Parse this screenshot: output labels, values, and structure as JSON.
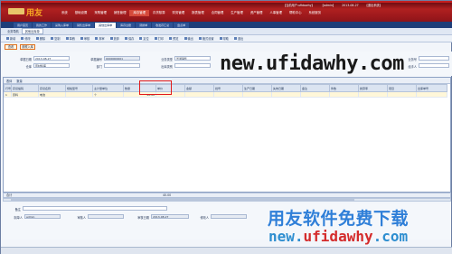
{
  "app": {
    "logo_text": "用友",
    "topinfo": [
      "【当前用户:ufidawhy】",
      "【admin】",
      "2013-08-27",
      "【退出系统】"
    ]
  },
  "top_menu": [
    "系统",
    "基础设置",
    "采购管理",
    "销售管理",
    "库存管理",
    "存货核算",
    "财务管理",
    "报表管理",
    "合同管理",
    "生产管理",
    "资产管理",
    "人事管理",
    "帮助中心",
    "系统服务",
    "工作台"
  ],
  "tabs": [
    "用户首页",
    "我的工作",
    "采购入库单",
    "销售出库单",
    "其他出库单",
    "库存台账",
    "调拨单",
    "收发存汇总",
    "盘点单"
  ],
  "crumbs": [
    "业务导航",
    "其他出库单"
  ],
  "toolbar": [
    "新增",
    "修改",
    "删除",
    "复制",
    "草稿",
    "审核",
    "弃审",
    "放弃",
    "保存",
    "定位",
    "打印",
    "预览",
    "输出",
    "格式设置",
    "帮助",
    "退出"
  ],
  "buttons": {
    "btn1": "查看",
    "btn2": "参照入库"
  },
  "form": {
    "doc_date_label": "单据日期",
    "doc_date": "2013-08-27",
    "doc_no_label": "单据编号",
    "doc_no": "0000000001",
    "warehouse_label": "仓库",
    "warehouse": "原材料库",
    "biz_type_label": "业务类型",
    "biz_type": "普通销售",
    "dept_label": "部门",
    "dept": "",
    "out_type_label": "出库类别",
    "out_type": "",
    "biz_no_label": "业务号",
    "biz_no": "",
    "handler_label": "经手人",
    "handler": "",
    "remark_label": "备注",
    "remark": ""
  },
  "watermark": {
    "top": "new.ufidawhy.com",
    "cn": "用友软件免费下载",
    "bottom_pre": "new.",
    "bottom_cn": "ufidawhy",
    "bottom_post": ".com"
  },
  "grid": {
    "title": [
      "表体",
      "数量"
    ],
    "headers": [
      "行号",
      "存货编码",
      "存货名称",
      "规格型号",
      "主计量单位",
      "数量",
      "单价",
      "金额",
      "批号",
      "生产日期",
      "失效日期",
      "备注",
      "件数",
      "换算率",
      "项目",
      "出库单号"
    ],
    "rows": [
      [
        "1",
        "原料",
        "电池",
        "",
        "个",
        "40.00",
        "",
        "",
        "",
        "",
        "",
        "",
        "",
        "",
        "",
        ""
      ]
    ]
  },
  "totals": {
    "label": "合计",
    "qty": "40.00",
    "amount": ""
  },
  "footer": {
    "maker_label": "制单人",
    "maker": "admin",
    "reviewer_label": "审核人",
    "reviewer": "",
    "review_date_label": "审核日期",
    "review_date": "2013-08-27",
    "modifier_label": "修改人",
    "modifier": ""
  },
  "colors": {
    "accent": "#b02020",
    "nav": "#1e3e79",
    "highlight": "#e31b1b"
  }
}
